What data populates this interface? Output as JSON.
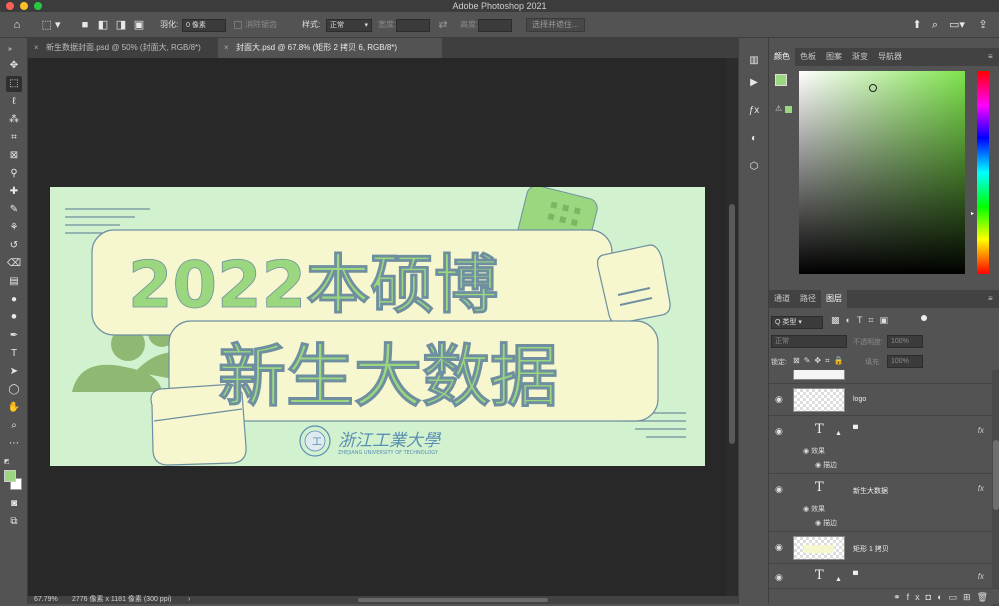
{
  "window": {
    "title": "Adobe Photoshop 2021"
  },
  "options_bar": {
    "feather_label": "羽化:",
    "feather_value": "0 像素",
    "antialias_label": "消除锯齿",
    "style_label": "样式:",
    "style_value": "正常",
    "width_label": "宽度:",
    "height_label": "高度:",
    "select_subject_label": "选择并遮住..."
  },
  "tabs": [
    {
      "label": "新生数据封面.psd @ 50% (封面大, RGB/8*)",
      "close": "×"
    },
    {
      "label": "封面大.psd @ 67.8% (矩形 2 拷贝 6, RGB/8*)",
      "close": "×"
    }
  ],
  "status": {
    "zoom": "67.79%",
    "doc_info": "2776 像素 x 1181 像素 (300 ppi)",
    "arrow": "›"
  },
  "artwork": {
    "headline_top": "2022本硕博",
    "headline_bottom": "新生大数据",
    "university_cn": "浙江工業大學",
    "university_en": "ZHEJIANG UNIVERSITY OF TECHNOLOGY"
  },
  "color_panel": {
    "tabs": [
      "颜色",
      "色板",
      "图案",
      "渐变",
      "导航器"
    ],
    "foreground": "#9ad77f",
    "background": "#ffffff",
    "hue_color": "#7ee34c"
  },
  "layers_panel": {
    "tabs": [
      "通道",
      "路径",
      "图层"
    ],
    "filter_label": "Q 类型",
    "blend_mode": "正常",
    "opacity_label": "不透明度:",
    "opacity_value": "100%",
    "lock_label": "锁定:",
    "fill_label": "填充:",
    "fill_value": "100%",
    "layers": [
      {
        "name": "logo",
        "kind": "image"
      },
      {
        "name": "",
        "kind": "text",
        "fx": "fx",
        "effects_label": "效果",
        "effect": "描边"
      },
      {
        "name": "新生大数据",
        "kind": "text",
        "fx": "fx",
        "effects_label": "效果",
        "effect": "描边"
      },
      {
        "name": "矩形 1 拷贝",
        "kind": "image"
      },
      {
        "name": "",
        "kind": "text",
        "fx": "fx"
      }
    ],
    "bottom_icons": [
      "link-icon",
      "fx",
      "mask-icon",
      "adjustment-icon",
      "group-icon",
      "new-layer-icon",
      "trash-icon"
    ]
  },
  "colors": {
    "doc_bg": "#d2f1cf",
    "card_fill": "#f6f7cf",
    "text_green": "#9ad77f",
    "stroke": "#6f8fa0",
    "dark_green": "#8fb872",
    "university_blue": "#5b8fb2"
  }
}
